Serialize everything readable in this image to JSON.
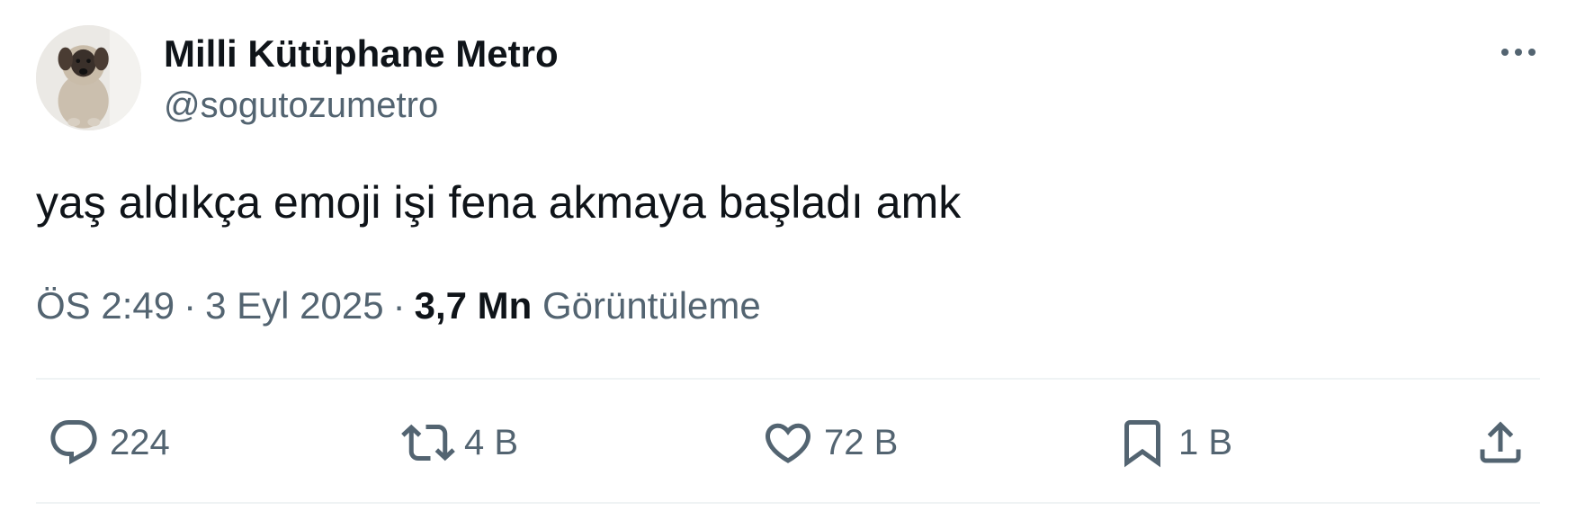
{
  "author": {
    "display_name": "Milli Kütüphane Metro",
    "handle": "@sogutozumetro",
    "avatar": "puppy-avatar"
  },
  "tweet": {
    "text": "yaş aldıkça emoji işi fena akmaya başladı amk"
  },
  "meta": {
    "time": "ÖS 2:49",
    "separator": "·",
    "date": "3 Eyl 2025",
    "views_count": "3,7 Mn",
    "views_label": "Görüntüleme"
  },
  "actions": {
    "reply": {
      "icon": "reply-icon",
      "count": "224"
    },
    "retweet": {
      "icon": "retweet-icon",
      "count": "4 B"
    },
    "like": {
      "icon": "heart-icon",
      "count": "72 B"
    },
    "bookmark": {
      "icon": "bookmark-icon",
      "count": "1 B"
    },
    "share": {
      "icon": "share-icon"
    }
  },
  "more_menu": {
    "icon": "more-icon"
  },
  "colors": {
    "text_primary": "#0f1419",
    "text_secondary": "#536471",
    "divider": "#eff3f4",
    "background": "#ffffff"
  }
}
